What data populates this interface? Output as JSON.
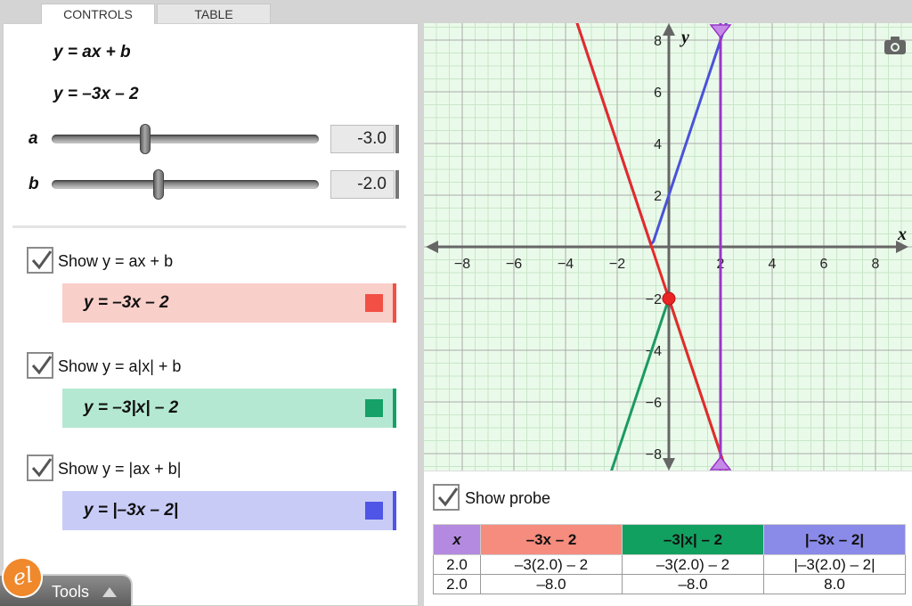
{
  "tabs": [
    {
      "label": "CONTROLS",
      "active": true
    },
    {
      "label": "TABLE",
      "active": false
    }
  ],
  "equations": {
    "general": "y = ax + b",
    "specific": "y = –3x – 2"
  },
  "sliders": [
    {
      "label": "a",
      "value": "-3.0",
      "numeric": -3.0,
      "min": -10,
      "max": 10
    },
    {
      "label": "b",
      "value": "-2.0",
      "numeric": -2.0,
      "min": -10,
      "max": 10
    }
  ],
  "functions": [
    {
      "show_label": "Show y = ax + b",
      "checked": true,
      "formula": "y = –3x – 2",
      "color": "#f25045",
      "bg": "#f9cfc9"
    },
    {
      "show_label": "Show y = a|x| + b",
      "checked": true,
      "formula": "y = –3|x| – 2",
      "color": "#15a168",
      "bg": "#b5e8d2"
    },
    {
      "show_label": "Show y = |ax + b|",
      "checked": true,
      "formula": "y = |–3x – 2|",
      "color": "#4f55e6",
      "bg": "#c9cbf7"
    }
  ],
  "tools": {
    "label": "Tools",
    "logo": "el"
  },
  "graph": {
    "x_axis_label": "x",
    "y_axis_label": "y",
    "x_ticks": [
      "−8",
      "−6",
      "−4",
      "−2",
      "2",
      "4",
      "6",
      "8"
    ],
    "y_ticks": [
      "8",
      "6",
      "4",
      "2",
      "−2",
      "−4",
      "−6",
      "−8"
    ],
    "probe_x": 2.0,
    "colors": {
      "linear": "#e52b2b",
      "abs_x": "#1c9a63",
      "abs_all": "#4a52d8",
      "probe": "#9a36c8"
    }
  },
  "probe": {
    "label": "Show probe",
    "checked": true,
    "headers": [
      "x",
      "–3x – 2",
      "–3|x| – 2",
      "|–3x – 2|"
    ],
    "header_colors": [
      "#b48ae0",
      "#f58c7e",
      "#12a060",
      "#8a8ae8"
    ],
    "rows": [
      [
        "2.0",
        "–3(2.0) – 2",
        "–3(2.0) – 2",
        "|–3(2.0) – 2|"
      ],
      [
        "2.0",
        "–8.0",
        "–8.0",
        "8.0"
      ]
    ]
  }
}
